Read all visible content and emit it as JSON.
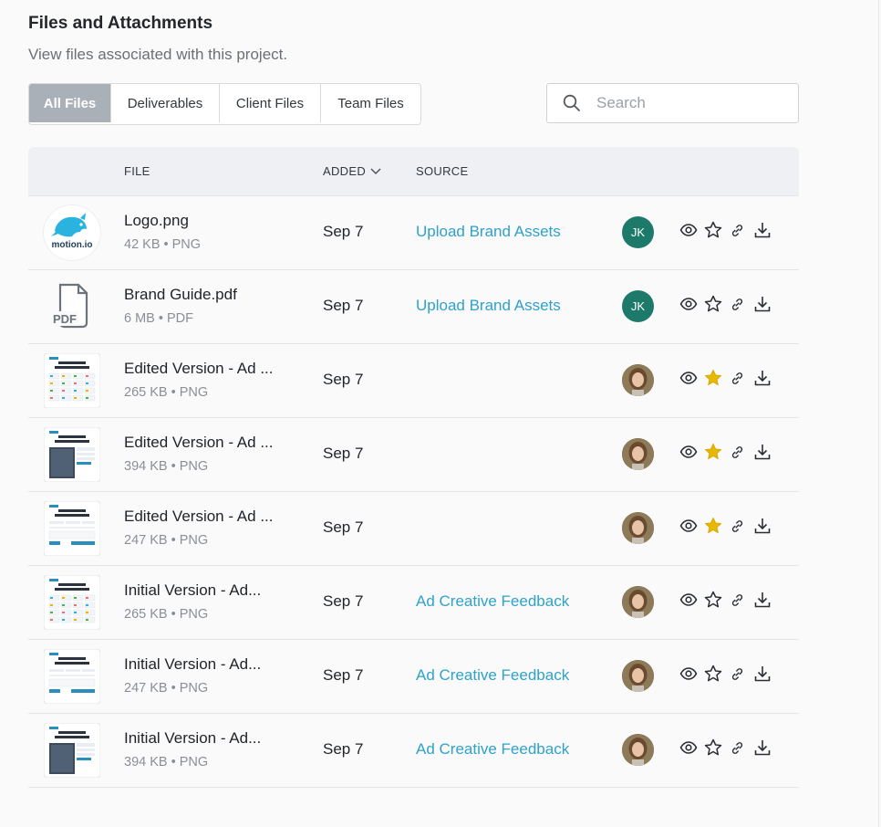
{
  "header": {
    "title": "Files and Attachments",
    "subtitle": "View files associated with this project."
  },
  "tabs": [
    {
      "label": "All Files",
      "active": true
    },
    {
      "label": "Deliverables",
      "active": false
    },
    {
      "label": "Client Files",
      "active": false
    },
    {
      "label": "Team Files",
      "active": false
    }
  ],
  "search": {
    "placeholder": "Search",
    "value": ""
  },
  "table": {
    "columns": {
      "file": "FILE",
      "added": "ADDED",
      "source": "SOURCE"
    },
    "rows": [
      {
        "name": "Logo.png",
        "meta": "42 KB • PNG",
        "added": "Sep 7",
        "source": "Upload Brand Assets",
        "avatar": "JK",
        "starred": false,
        "thumb": "logo"
      },
      {
        "name": "Brand Guide.pdf",
        "meta": "6 MB • PDF",
        "added": "Sep 7",
        "source": "Upload Brand Assets",
        "avatar": "JK",
        "starred": false,
        "thumb": "pdf"
      },
      {
        "name": "Edited Version - Ad ...",
        "meta": "265 KB • PNG",
        "added": "Sep 7",
        "source": "",
        "avatar": "photo",
        "starred": true,
        "thumb": "grid"
      },
      {
        "name": "Edited Version - Ad ...",
        "meta": "394 KB • PNG",
        "added": "Sep 7",
        "source": "",
        "avatar": "photo",
        "starred": true,
        "thumb": "dark"
      },
      {
        "name": "Edited Version - Ad ...",
        "meta": "247 KB • PNG",
        "added": "Sep 7",
        "source": "",
        "avatar": "photo",
        "starred": true,
        "thumb": "form"
      },
      {
        "name": "Initial Version - Ad...",
        "meta": "265 KB • PNG",
        "added": "Sep 7",
        "source": "Ad Creative Feedback",
        "avatar": "photo",
        "starred": false,
        "thumb": "grid"
      },
      {
        "name": "Initial Version - Ad...",
        "meta": "247 KB • PNG",
        "added": "Sep 7",
        "source": "Ad Creative Feedback",
        "avatar": "photo",
        "starred": false,
        "thumb": "form"
      },
      {
        "name": "Initial Version - Ad...",
        "meta": "394 KB • PNG",
        "added": "Sep 7",
        "source": "Ad Creative Feedback",
        "avatar": "photo",
        "starred": false,
        "thumb": "dark"
      }
    ]
  },
  "logo_text": "motion.io",
  "pdf_label": "PDF",
  "colors": {
    "accent": "#2ea2c9",
    "avatar_bg": "#1d7a6a",
    "star": "#e6b800",
    "tab_active": "#aab0b8"
  },
  "icons": {
    "view": "eye-icon",
    "star": "star-icon",
    "link": "link-icon",
    "download": "download-icon",
    "search": "search-icon",
    "sort": "chevron-down-icon"
  }
}
